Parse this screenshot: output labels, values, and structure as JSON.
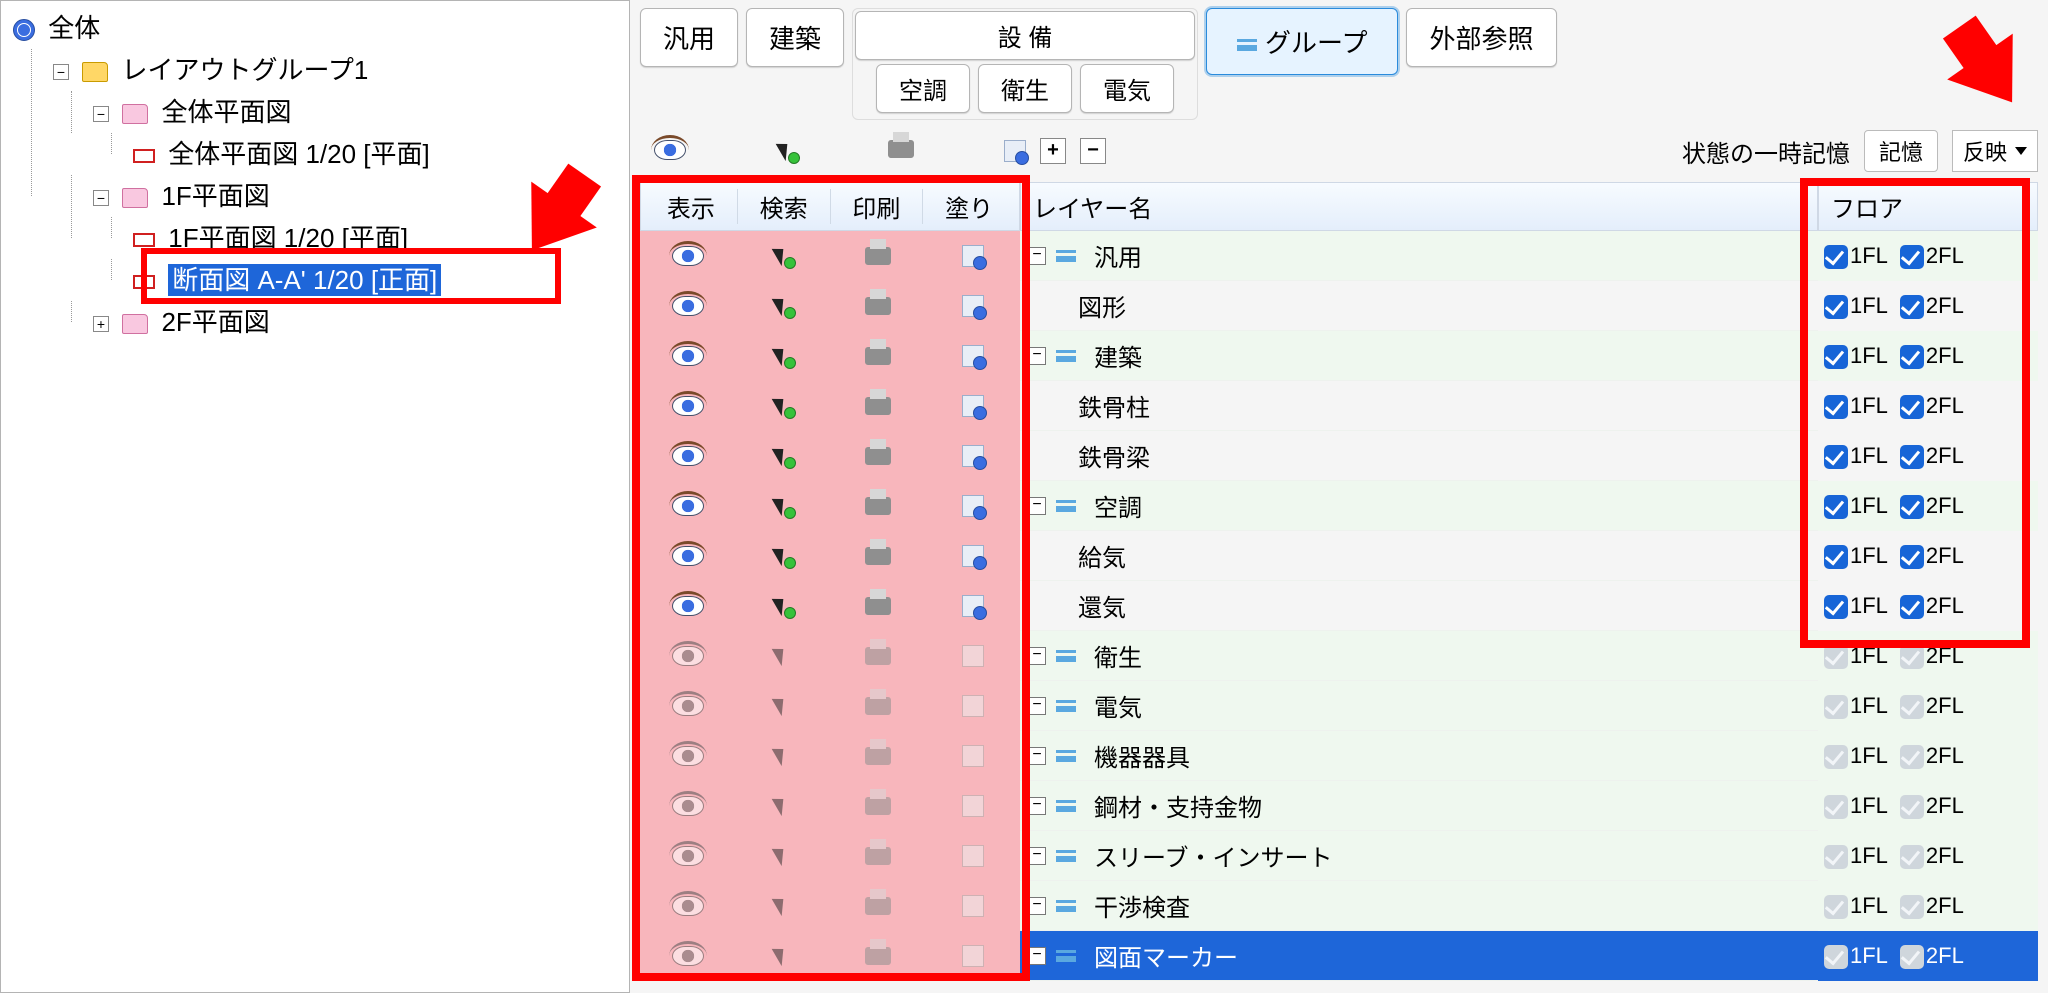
{
  "tree": {
    "root": "全体",
    "group": "レイアウトグループ1",
    "n1": "全体平面図",
    "n1a": "全体平面図 1/20 [平面]",
    "n2": "1F平面図",
    "n2a": "1F平面図 1/20 [平面]",
    "n2b": "断面図 A-A' 1/20 [正面]",
    "n3": "2F平面図"
  },
  "tabs": {
    "generic": "汎用",
    "arch": "建築",
    "equip": "設 備",
    "hvac": "空調",
    "sanitary": "衛生",
    "elec": "電気",
    "group": "グループ",
    "extref": "外部参照"
  },
  "state": {
    "label": "状態の一時記憶",
    "save": "記憶",
    "apply": "反映"
  },
  "cols": {
    "show": "表示",
    "search": "検索",
    "print": "印刷",
    "paint": "塗り",
    "name": "レイヤー名",
    "floor": "フロア"
  },
  "floors": {
    "f1": "1FL",
    "f2": "2FL"
  },
  "layers": [
    {
      "name": "汎用",
      "group": true,
      "active": true
    },
    {
      "name": "図形",
      "group": false,
      "active": true
    },
    {
      "name": "建築",
      "group": true,
      "active": true
    },
    {
      "name": "鉄骨柱",
      "group": false,
      "active": true
    },
    {
      "name": "鉄骨梁",
      "group": false,
      "active": true
    },
    {
      "name": "空調",
      "group": true,
      "active": true
    },
    {
      "name": "給気",
      "group": false,
      "active": true
    },
    {
      "name": "還気",
      "group": false,
      "active": true
    },
    {
      "name": "衛生",
      "group": true,
      "active": false
    },
    {
      "name": "電気",
      "group": true,
      "active": false
    },
    {
      "name": "機器器具",
      "group": true,
      "active": false
    },
    {
      "name": "鋼材・支持金物",
      "group": true,
      "active": false
    },
    {
      "name": "スリーブ・インサート",
      "group": true,
      "active": false
    },
    {
      "name": "干渉検査",
      "group": true,
      "active": false
    },
    {
      "name": "図面マーカー",
      "group": true,
      "active": false,
      "selected": true
    }
  ]
}
